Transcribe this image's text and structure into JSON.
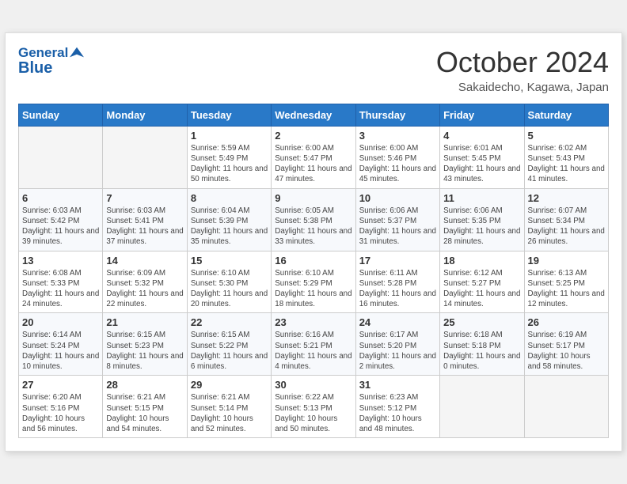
{
  "header": {
    "logo_line1": "General",
    "logo_line2": "Blue",
    "month": "October 2024",
    "location": "Sakaidecho, Kagawa, Japan"
  },
  "days_of_week": [
    "Sunday",
    "Monday",
    "Tuesday",
    "Wednesday",
    "Thursday",
    "Friday",
    "Saturday"
  ],
  "weeks": [
    [
      {
        "day": "",
        "content": ""
      },
      {
        "day": "",
        "content": ""
      },
      {
        "day": "1",
        "content": "Sunrise: 5:59 AM\nSunset: 5:49 PM\nDaylight: 11 hours and 50 minutes."
      },
      {
        "day": "2",
        "content": "Sunrise: 6:00 AM\nSunset: 5:47 PM\nDaylight: 11 hours and 47 minutes."
      },
      {
        "day": "3",
        "content": "Sunrise: 6:00 AM\nSunset: 5:46 PM\nDaylight: 11 hours and 45 minutes."
      },
      {
        "day": "4",
        "content": "Sunrise: 6:01 AM\nSunset: 5:45 PM\nDaylight: 11 hours and 43 minutes."
      },
      {
        "day": "5",
        "content": "Sunrise: 6:02 AM\nSunset: 5:43 PM\nDaylight: 11 hours and 41 minutes."
      }
    ],
    [
      {
        "day": "6",
        "content": "Sunrise: 6:03 AM\nSunset: 5:42 PM\nDaylight: 11 hours and 39 minutes."
      },
      {
        "day": "7",
        "content": "Sunrise: 6:03 AM\nSunset: 5:41 PM\nDaylight: 11 hours and 37 minutes."
      },
      {
        "day": "8",
        "content": "Sunrise: 6:04 AM\nSunset: 5:39 PM\nDaylight: 11 hours and 35 minutes."
      },
      {
        "day": "9",
        "content": "Sunrise: 6:05 AM\nSunset: 5:38 PM\nDaylight: 11 hours and 33 minutes."
      },
      {
        "day": "10",
        "content": "Sunrise: 6:06 AM\nSunset: 5:37 PM\nDaylight: 11 hours and 31 minutes."
      },
      {
        "day": "11",
        "content": "Sunrise: 6:06 AM\nSunset: 5:35 PM\nDaylight: 11 hours and 28 minutes."
      },
      {
        "day": "12",
        "content": "Sunrise: 6:07 AM\nSunset: 5:34 PM\nDaylight: 11 hours and 26 minutes."
      }
    ],
    [
      {
        "day": "13",
        "content": "Sunrise: 6:08 AM\nSunset: 5:33 PM\nDaylight: 11 hours and 24 minutes."
      },
      {
        "day": "14",
        "content": "Sunrise: 6:09 AM\nSunset: 5:32 PM\nDaylight: 11 hours and 22 minutes."
      },
      {
        "day": "15",
        "content": "Sunrise: 6:10 AM\nSunset: 5:30 PM\nDaylight: 11 hours and 20 minutes."
      },
      {
        "day": "16",
        "content": "Sunrise: 6:10 AM\nSunset: 5:29 PM\nDaylight: 11 hours and 18 minutes."
      },
      {
        "day": "17",
        "content": "Sunrise: 6:11 AM\nSunset: 5:28 PM\nDaylight: 11 hours and 16 minutes."
      },
      {
        "day": "18",
        "content": "Sunrise: 6:12 AM\nSunset: 5:27 PM\nDaylight: 11 hours and 14 minutes."
      },
      {
        "day": "19",
        "content": "Sunrise: 6:13 AM\nSunset: 5:25 PM\nDaylight: 11 hours and 12 minutes."
      }
    ],
    [
      {
        "day": "20",
        "content": "Sunrise: 6:14 AM\nSunset: 5:24 PM\nDaylight: 11 hours and 10 minutes."
      },
      {
        "day": "21",
        "content": "Sunrise: 6:15 AM\nSunset: 5:23 PM\nDaylight: 11 hours and 8 minutes."
      },
      {
        "day": "22",
        "content": "Sunrise: 6:15 AM\nSunset: 5:22 PM\nDaylight: 11 hours and 6 minutes."
      },
      {
        "day": "23",
        "content": "Sunrise: 6:16 AM\nSunset: 5:21 PM\nDaylight: 11 hours and 4 minutes."
      },
      {
        "day": "24",
        "content": "Sunrise: 6:17 AM\nSunset: 5:20 PM\nDaylight: 11 hours and 2 minutes."
      },
      {
        "day": "25",
        "content": "Sunrise: 6:18 AM\nSunset: 5:18 PM\nDaylight: 11 hours and 0 minutes."
      },
      {
        "day": "26",
        "content": "Sunrise: 6:19 AM\nSunset: 5:17 PM\nDaylight: 10 hours and 58 minutes."
      }
    ],
    [
      {
        "day": "27",
        "content": "Sunrise: 6:20 AM\nSunset: 5:16 PM\nDaylight: 10 hours and 56 minutes."
      },
      {
        "day": "28",
        "content": "Sunrise: 6:21 AM\nSunset: 5:15 PM\nDaylight: 10 hours and 54 minutes."
      },
      {
        "day": "29",
        "content": "Sunrise: 6:21 AM\nSunset: 5:14 PM\nDaylight: 10 hours and 52 minutes."
      },
      {
        "day": "30",
        "content": "Sunrise: 6:22 AM\nSunset: 5:13 PM\nDaylight: 10 hours and 50 minutes."
      },
      {
        "day": "31",
        "content": "Sunrise: 6:23 AM\nSunset: 5:12 PM\nDaylight: 10 hours and 48 minutes."
      },
      {
        "day": "",
        "content": ""
      },
      {
        "day": "",
        "content": ""
      }
    ]
  ]
}
